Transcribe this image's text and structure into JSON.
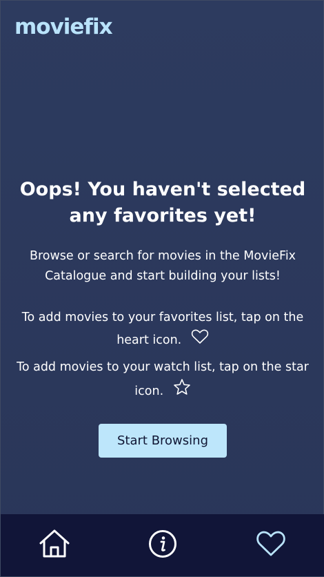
{
  "app": {
    "logo_text": "moviefix"
  },
  "empty_state": {
    "headline": "Oops! You haven't selected any favorites yet!",
    "subtext": "Browse or search for movies in the MovieFix Catalogue and start building your lists!",
    "favorites_tip": "To add movies to your favorites list, tap on the heart icon.",
    "watchlist_tip": "To add movies to your watch list, tap on the star icon.",
    "button_label": "Start Browsing"
  },
  "nav": {
    "items": [
      {
        "name": "home",
        "icon": "home-icon"
      },
      {
        "name": "info",
        "icon": "info-icon"
      },
      {
        "name": "favorites",
        "icon": "heart-icon",
        "active": true
      }
    ]
  },
  "colors": {
    "background": "#2b3a5e",
    "logo": "#b9e3fb",
    "button": "#bde6fb",
    "nav_background": "#111538",
    "nav_active": "#b9e3fb",
    "nav_inactive": "#ffffff"
  }
}
